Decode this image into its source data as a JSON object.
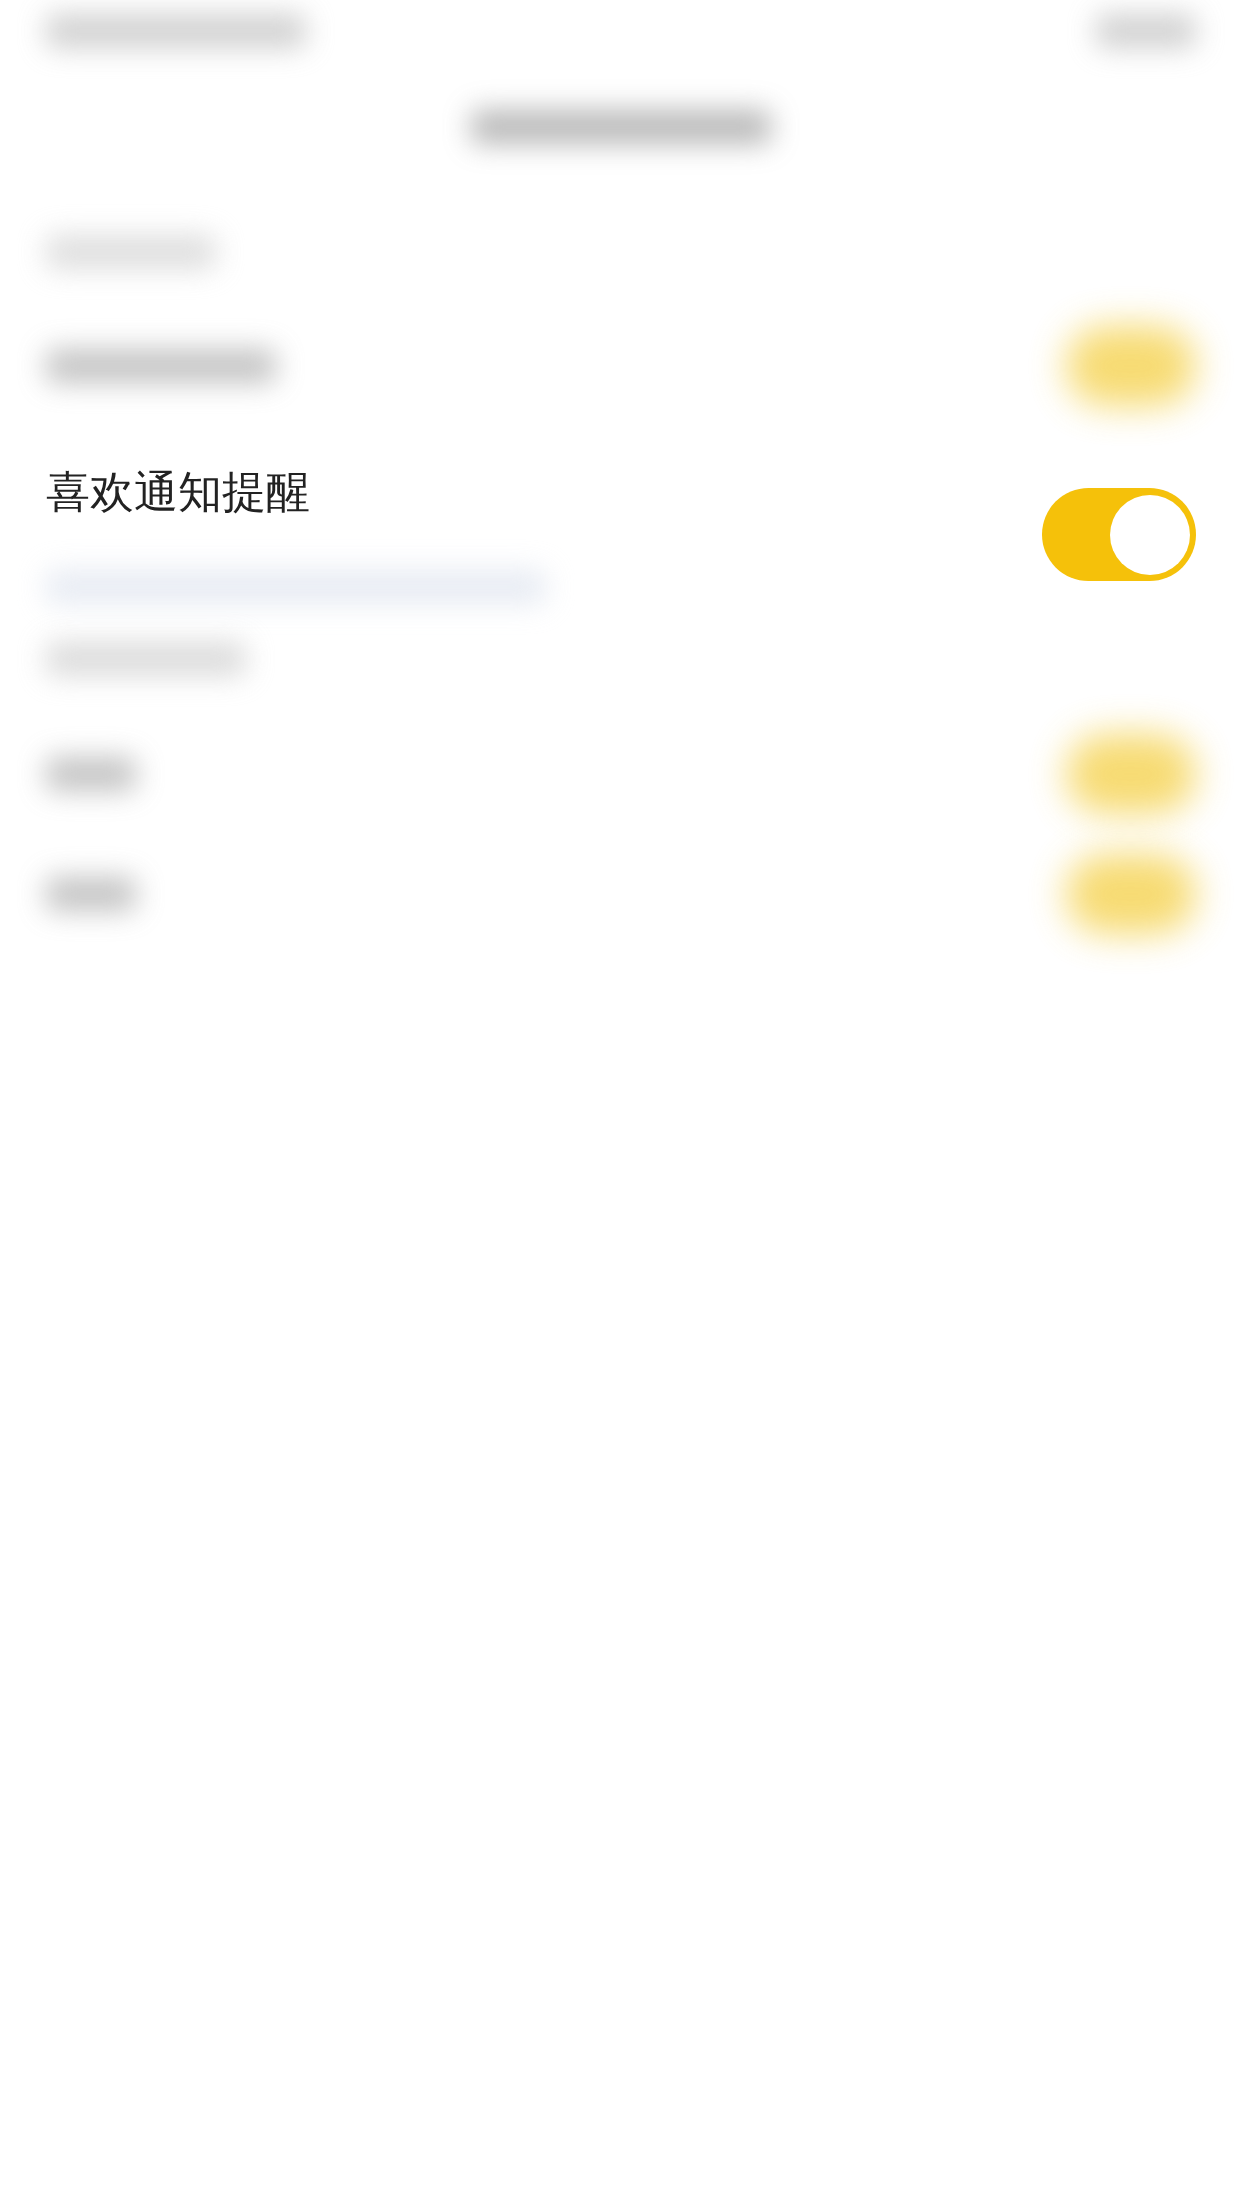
{
  "blurred_toggles": [
    {
      "on": true
    },
    {
      "on": true
    },
    {
      "on": true
    }
  ],
  "setting": {
    "label": "喜欢通知提醒",
    "on": true
  }
}
